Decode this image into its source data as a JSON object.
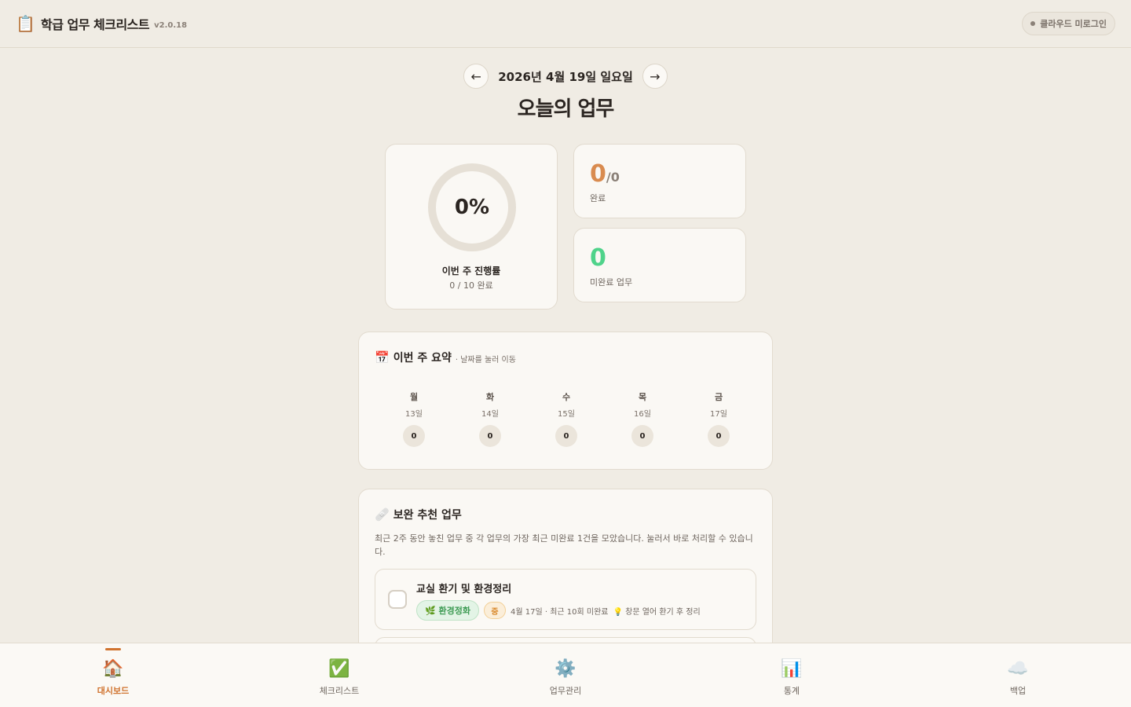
{
  "app": {
    "title": "학급 업무 체크리스트",
    "version": "v2.0.18",
    "logo_icon": "📋",
    "cloud_login": "클라우드 미로그인"
  },
  "date_nav": {
    "prev": "←",
    "date": "2026년 4월 19일 일요일",
    "next": "→"
  },
  "page_title": "오늘의 업무",
  "progress": {
    "percent_text": "0%",
    "percent": 0,
    "label": "이번 주 진행률",
    "sub": "0 / 10 완료"
  },
  "stats": {
    "done": {
      "value": "0",
      "total": "/0",
      "label": "완료",
      "color": "#d98b4f"
    },
    "todo": {
      "value": "0",
      "label": "미완료 업무",
      "color": "#4fd38a"
    }
  },
  "week": {
    "icon": "📅",
    "title": "이번 주 요약",
    "hint": "· 날짜를 눌러 이동",
    "days": [
      {
        "name": "월",
        "date": "13일",
        "count": "0"
      },
      {
        "name": "화",
        "date": "14일",
        "count": "0"
      },
      {
        "name": "수",
        "date": "15일",
        "count": "0"
      },
      {
        "name": "목",
        "date": "16일",
        "count": "0"
      },
      {
        "name": "금",
        "date": "17일",
        "count": "0"
      }
    ]
  },
  "recommend": {
    "icon": "🩹",
    "title": "보완 추천 업무",
    "desc": "최근 2주 동안 놓친 업무 중 각 업무의 가장 최근 미완료 1건을 모았습니다. 눌러서 바로 처리할 수 있습니다.",
    "tasks": [
      {
        "title": "교실 환기 및 환경정리",
        "category": "🌿 환경정화",
        "priority": "중",
        "date": "4월 17일 · 최근 10회 미완료",
        "tip": "💡 창문 열어 환기 후 정리"
      }
    ]
  },
  "bottom_nav": [
    {
      "icon": "🏠",
      "label": "대시보드",
      "active": true
    },
    {
      "icon": "✅",
      "label": "체크리스트",
      "active": false
    },
    {
      "icon": "⚙️",
      "label": "업무관리",
      "active": false
    },
    {
      "icon": "📊",
      "label": "통계",
      "active": false
    },
    {
      "icon": "☁️",
      "label": "백업",
      "active": false
    }
  ]
}
